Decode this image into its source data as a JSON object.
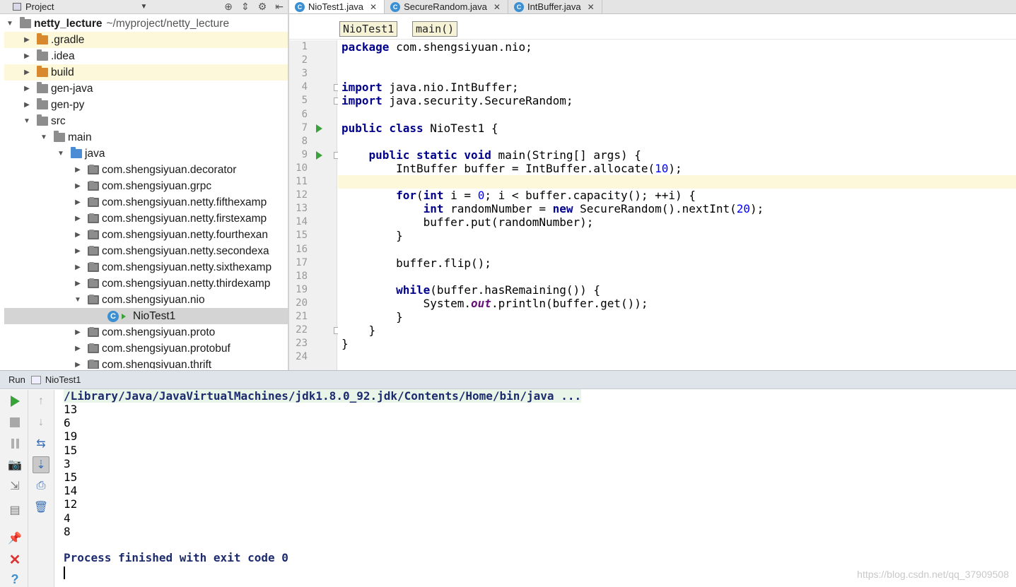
{
  "project_panel": {
    "title": "Project",
    "tree": [
      {
        "label": "netty_lecture",
        "path": "~/myproject/netty_lecture",
        "indent": 0,
        "arrow": "▼",
        "folder": "gray",
        "bold": true
      },
      {
        "label": ".gradle",
        "indent": 1,
        "arrow": "▶",
        "folder": "orange",
        "highlight": true
      },
      {
        "label": ".idea",
        "indent": 1,
        "arrow": "▶",
        "folder": "gray"
      },
      {
        "label": "build",
        "indent": 1,
        "arrow": "▶",
        "folder": "orange",
        "highlight": true
      },
      {
        "label": "gen-java",
        "indent": 1,
        "arrow": "▶",
        "folder": "gray"
      },
      {
        "label": "gen-py",
        "indent": 1,
        "arrow": "▶",
        "folder": "gray"
      },
      {
        "label": "src",
        "indent": 1,
        "arrow": "▼",
        "folder": "gray"
      },
      {
        "label": "main",
        "indent": 2,
        "arrow": "▼",
        "folder": "gray"
      },
      {
        "label": "java",
        "indent": 3,
        "arrow": "▼",
        "folder": "blue"
      },
      {
        "label": "com.shengsiyuan.decorator",
        "indent": 4,
        "arrow": "▶",
        "folder": "pkg"
      },
      {
        "label": "com.shengsiyuan.grpc",
        "indent": 4,
        "arrow": "▶",
        "folder": "pkg"
      },
      {
        "label": "com.shengsiyuan.netty.fifthexamp",
        "indent": 4,
        "arrow": "▶",
        "folder": "pkg"
      },
      {
        "label": "com.shengsiyuan.netty.firstexamp",
        "indent": 4,
        "arrow": "▶",
        "folder": "pkg"
      },
      {
        "label": "com.shengsiyuan.netty.fourthexan",
        "indent": 4,
        "arrow": "▶",
        "folder": "pkg"
      },
      {
        "label": "com.shengsiyuan.netty.secondexa",
        "indent": 4,
        "arrow": "▶",
        "folder": "pkg"
      },
      {
        "label": "com.shengsiyuan.netty.sixthexamp",
        "indent": 4,
        "arrow": "▶",
        "folder": "pkg"
      },
      {
        "label": "com.shengsiyuan.netty.thirdexamp",
        "indent": 4,
        "arrow": "▶",
        "folder": "pkg"
      },
      {
        "label": "com.shengsiyuan.nio",
        "indent": 4,
        "arrow": "▼",
        "folder": "pkg"
      },
      {
        "label": "NioTest1",
        "indent": 6,
        "arrow": "",
        "folder": "class",
        "selected": true
      },
      {
        "label": "com.shengsiyuan.proto",
        "indent": 4,
        "arrow": "▶",
        "folder": "pkg"
      },
      {
        "label": "com.shengsiyuan.protobuf",
        "indent": 4,
        "arrow": "▶",
        "folder": "pkg"
      },
      {
        "label": "com.shengsiyuan.thrift",
        "indent": 4,
        "arrow": "▶",
        "folder": "pkg"
      }
    ]
  },
  "editor": {
    "tabs": [
      {
        "label": "NioTest1.java",
        "active": true
      },
      {
        "label": "SecureRandom.java",
        "active": false
      },
      {
        "label": "IntBuffer.java",
        "active": false
      }
    ],
    "breadcrumbs": [
      "NioTest1",
      "main()"
    ],
    "current_line": 11,
    "lines": [
      "<span class=\"kw\">package</span> com.shengsiyuan.nio;",
      "",
      "",
      "<span class=\"kw\">import</span> java.nio.IntBuffer;",
      "<span class=\"kw\">import</span> java.security.SecureRandom;",
      "",
      "<span class=\"kw\">public class</span> NioTest1 {",
      "",
      "    <span class=\"kw\">public static void</span> main(String[] args) {",
      "        IntBuffer buffer = IntBuffer.allocate(<span class=\"num\">10</span>);",
      "",
      "        <span class=\"kw\">for</span>(<span class=\"kw\">int</span> i = <span class=\"num\">0</span>; i &lt; buffer.capacity(); ++i) {",
      "            <span class=\"kw\">int</span> randomNumber = <span class=\"kw\">new</span> SecureRandom().nextInt(<span class=\"num\">20</span>);",
      "            buffer.put(randomNumber);",
      "        }",
      "",
      "        buffer.flip();",
      "",
      "        <span class=\"kw\">while</span>(buffer.hasRemaining()) {",
      "            System.<span class=\"fld\">out</span>.println(buffer.get());",
      "        }",
      "    }",
      "}",
      ""
    ],
    "run_markers": [
      7,
      9
    ],
    "fold_markers": [
      4,
      5,
      9,
      22
    ]
  },
  "run_panel": {
    "label": "Run",
    "tab_label": "NioTest1",
    "command": "/Library/Java/JavaVirtualMachines/jdk1.8.0_92.jdk/Contents/Home/bin/java ...",
    "output": [
      "13",
      "6",
      "19",
      "15",
      "3",
      "15",
      "14",
      "12",
      "4",
      "8"
    ],
    "exit_message": "Process finished with exit code 0"
  },
  "watermark": "https://blog.csdn.net/qq_37909508",
  "colors": {
    "keyword": "#00008b",
    "number": "#0000ff",
    "run_green": "#3aa23a",
    "highlight_row": "#fcf8d9",
    "selected_row": "#d4d4d4"
  }
}
